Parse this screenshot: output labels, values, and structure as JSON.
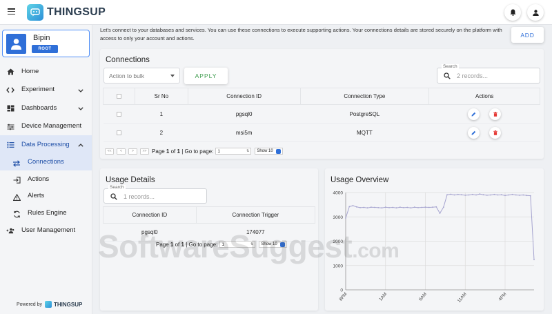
{
  "app": {
    "logo_text": "THINGSUP",
    "powered_by_label": "Powered by",
    "powered_by_brand": "THINGSUP"
  },
  "user": {
    "name": "Bipin",
    "role": "ROOT"
  },
  "sidebar": {
    "items": [
      {
        "label": "Home",
        "icon": "home-icon"
      },
      {
        "label": "Experiment",
        "icon": "code-icon",
        "expandable": true
      },
      {
        "label": "Dashboards",
        "icon": "dashboard-icon",
        "expandable": true
      },
      {
        "label": "Device Management",
        "icon": "sliders-icon"
      },
      {
        "label": "Data Processing",
        "icon": "list-icon",
        "expanded": true,
        "children": [
          {
            "label": "Connections",
            "icon": "swap-arrows-icon",
            "selected": true
          },
          {
            "label": "Actions",
            "icon": "login-arrow-icon"
          },
          {
            "label": "Alerts",
            "icon": "warning-icon"
          },
          {
            "label": "Rules Engine",
            "icon": "sync-icon"
          }
        ]
      },
      {
        "label": "User Management",
        "icon": "users-icon"
      }
    ]
  },
  "intro_text": "Let's connect to your databases and services. You can use these connections to execute supporting actions. Your connections details are stored securely on the platform with access to only your account and actions.",
  "add_label": "ADD",
  "connections": {
    "title": "Connections",
    "bulk_placeholder": "Action to bulk",
    "apply_label": "APPLY",
    "search_label": "Search",
    "search_placeholder": "2 records...",
    "columns": [
      "Sr No",
      "Connection ID",
      "Connection Type",
      "Actions"
    ],
    "rows": [
      {
        "sr": "1",
        "id": "pgsql0",
        "type": "PostgreSQL"
      },
      {
        "sr": "2",
        "id": "msi5m",
        "type": "MQTT"
      }
    ],
    "pager": {
      "first": "<<",
      "prev": "<",
      "next": ">",
      "last": ">>",
      "page_word": "Page",
      "current": "1",
      "of_word": "of",
      "total": "1",
      "goto_label": "| Go to page:",
      "goto_value": "1",
      "show_label": "Show 10"
    }
  },
  "usage_details": {
    "title": "Usage Details",
    "search_label": "Search",
    "search_placeholder": "1 records...",
    "columns": [
      "Connection ID",
      "Connection Trigger"
    ],
    "rows": [
      {
        "id": "pgsql0",
        "trigger": "174077"
      }
    ],
    "pager": {
      "page_word": "Page",
      "current": "1",
      "of_word": "of",
      "total": "1",
      "goto_label": "| Go to page:",
      "goto_value": "1",
      "show_label": "Show 10"
    }
  },
  "usage_overview": {
    "title": "Usage Overview"
  },
  "chart_data": {
    "type": "line",
    "title": "Usage Overview",
    "x": [
      "8PM",
      "",
      "",
      "",
      "",
      "",
      "",
      "",
      "",
      "",
      "",
      "1AM",
      "",
      "",
      "",
      "",
      "",
      "",
      "",
      "",
      "",
      "",
      "6AM",
      "",
      "",
      "",
      "",
      "",
      "",
      "",
      "",
      "",
      "",
      "11AM",
      "",
      "",
      "",
      "",
      "",
      "",
      "",
      "",
      "",
      "",
      "4PM",
      "",
      "",
      "",
      "",
      "",
      ""
    ],
    "x_tick_labels": [
      "8PM",
      "1AM",
      "6AM",
      "11AM",
      "4PM"
    ],
    "values": [
      2950,
      3420,
      3460,
      3410,
      3380,
      3390,
      3370,
      3400,
      3390,
      3380,
      3370,
      3400,
      3380,
      3390,
      3370,
      3400,
      3380,
      3390,
      3370,
      3400,
      3380,
      3390,
      3400,
      3390,
      3400,
      3410,
      3150,
      3400,
      3910,
      3930,
      3900,
      3920,
      3910,
      3890,
      3900,
      3920,
      3900,
      3940,
      3910,
      3890,
      3900,
      3920,
      3900,
      3910,
      3880,
      3900,
      3920,
      3900,
      3890,
      3900,
      3880,
      3870,
      1240
    ],
    "y_ticks": [
      0,
      1000,
      2000,
      3000,
      4000
    ],
    "ylim": [
      0,
      4000
    ],
    "grid": true,
    "line_color": "#a5a3cf"
  },
  "watermark": {
    "main": "SoftwareSuggest",
    "suffix": ".com"
  }
}
